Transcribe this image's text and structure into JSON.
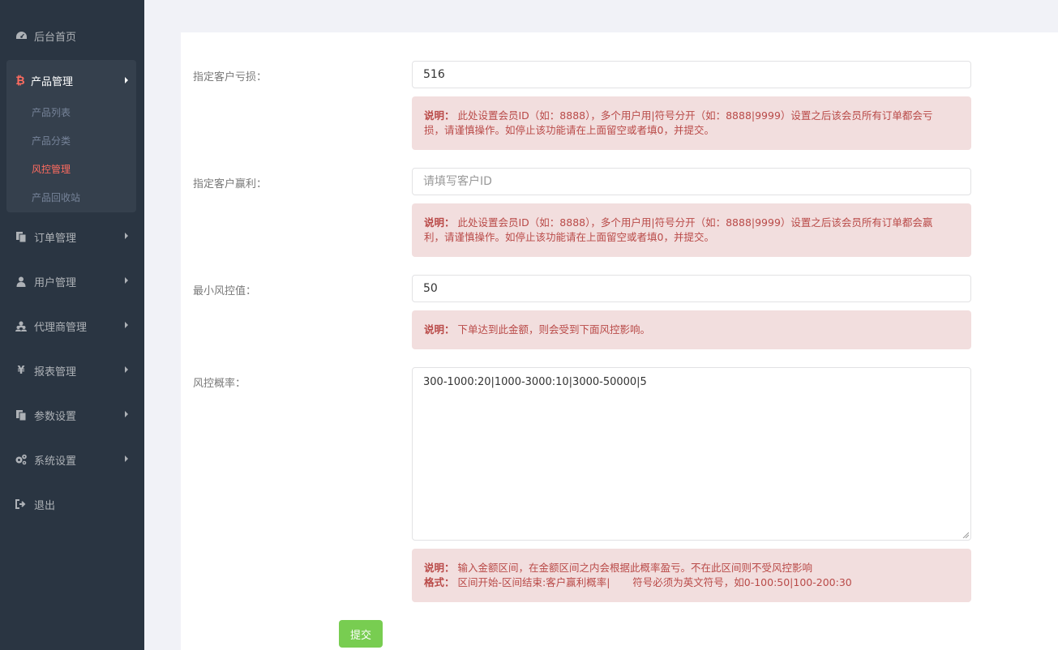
{
  "sidebar": {
    "items": [
      {
        "label": "后台首页",
        "icon": "dashboard-icon"
      },
      {
        "label": "产品管理",
        "icon": "bitcoin-icon"
      },
      {
        "label": "订单管理",
        "icon": "copy-icon"
      },
      {
        "label": "用户管理",
        "icon": "user-icon"
      },
      {
        "label": "代理商管理",
        "icon": "users-icon"
      },
      {
        "label": "报表管理",
        "icon": "yen-icon"
      },
      {
        "label": "参数设置",
        "icon": "copy-icon"
      },
      {
        "label": "系统设置",
        "icon": "cogs-icon"
      },
      {
        "label": "退出",
        "icon": "sign-out-icon"
      }
    ],
    "sub_items": [
      "产品列表",
      "产品分类",
      "风控管理",
      "产品回收站"
    ],
    "icons": {
      "yen": "¥",
      "bitcoin": "₿"
    },
    "accent_color": "#ff6c60"
  },
  "form": {
    "loss": {
      "label": "指定客户亏损：",
      "value": "516",
      "note_prefix": "说明：",
      "note_line1": "此处设置会员ID（如：8888），多个用户用|符号分开（如：8888|9999）设置之后该会员所有订单都会亏",
      "note_line2": "损，请谨慎操作。如停止该功能请在上面留空或者填0，并提交。"
    },
    "profit": {
      "label": "指定客户赢利：",
      "value": "",
      "placeholder": "请填写客户ID",
      "note_prefix": "说明：",
      "note_line1": "此处设置会员ID（如：8888），多个用户用|符号分开（如：8888|9999）设置之后该会员所有订单都会赢",
      "note_line2": "利，请谨慎操作。如停止该功能请在上面留空或者填0，并提交。"
    },
    "min_risk": {
      "label": "最小风控值：",
      "value": "50",
      "note_prefix": "说明：",
      "note_text": "下单达到此金额，则会受到下面风控影响。"
    },
    "rate": {
      "label": "风控概率：",
      "value": "300-1000:20|1000-3000:10|3000-50000|5",
      "note_prefix1": "说明：",
      "note_text1": "输入金额区间，在金额区间之内会根据此概率盈亏。不在此区间则不受风控影响",
      "note_prefix2": "格式：",
      "note_text2": "区间开始-区间结束:客户赢利概率|       符号必须为英文符号，如0-100:50|100-200:30"
    },
    "submit_label": "提交"
  }
}
